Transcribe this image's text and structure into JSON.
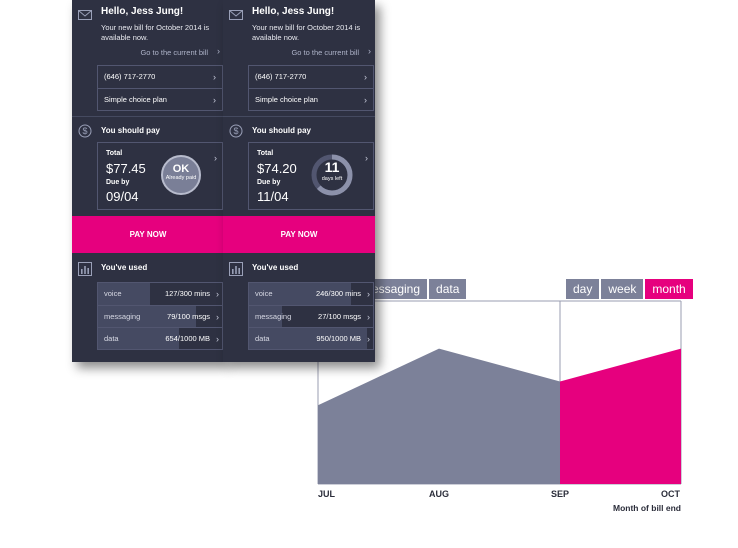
{
  "chart": {
    "metric_tabs": [
      {
        "label": "messaging",
        "active": false
      },
      {
        "label": "data",
        "active": false
      }
    ],
    "range_tabs": [
      {
        "label": "day",
        "active": false
      },
      {
        "label": "week",
        "active": false
      },
      {
        "label": "month",
        "active": true
      }
    ],
    "x_labels": [
      "JUL",
      "AUG",
      "SEP",
      "OCT"
    ],
    "x_axis_title": "Month of bill end",
    "colors": {
      "past": "#7c8199",
      "current": "#e6007e",
      "axis": "#9a9db0"
    }
  },
  "chart_data": {
    "type": "area",
    "categories": [
      "JUL",
      "AUG",
      "SEP",
      "OCT"
    ],
    "values": [
      0.43,
      0.74,
      0.56,
      0.74
    ],
    "highlight_from_index": 2,
    "xlabel": "Month of bill end",
    "ylabel": ""
  },
  "phones": [
    {
      "greeting": "Hello, Jess Jung!",
      "bill_message": "Your new bill for October 2014 is available now.",
      "bill_link": "Go to the current bill",
      "phone_number": "(646) 717-2770",
      "plan": "Simple choice plan",
      "pay_title": "You should pay",
      "total_label": "Total",
      "total_amount": "$77.45",
      "due_label": "Due by",
      "due_date": "09/04",
      "badge_type": "ok",
      "badge_main": "OK",
      "badge_sub": "Already paid",
      "pay_now": "PAY NOW",
      "used_title": "You've used",
      "usage": [
        {
          "name": "voice",
          "value": "127/300 mins",
          "fraction": 0.42
        },
        {
          "name": "messaging",
          "value": "79/100 msgs",
          "fraction": 0.79
        },
        {
          "name": "data",
          "value": "654/1000 MB",
          "fraction": 0.65
        }
      ]
    },
    {
      "greeting": "Hello, Jess Jung!",
      "bill_message": "Your new bill for October 2014 is available now.",
      "bill_link": "Go to the current bill",
      "phone_number": "(646) 717-2770",
      "plan": "Simple choice plan",
      "pay_title": "You should pay",
      "total_label": "Total",
      "total_amount": "$74.20",
      "due_label": "Due by",
      "due_date": "11/04",
      "badge_type": "ring",
      "badge_main": "11",
      "badge_sub": "days left",
      "ring_fraction": 0.63,
      "pay_now": "PAY NOW",
      "used_title": "You've used",
      "usage": [
        {
          "name": "voice",
          "value": "246/300 mins",
          "fraction": 0.82
        },
        {
          "name": "messaging",
          "value": "27/100 msgs",
          "fraction": 0.27
        },
        {
          "name": "data",
          "value": "950/1000 MB",
          "fraction": 0.95
        }
      ]
    }
  ]
}
